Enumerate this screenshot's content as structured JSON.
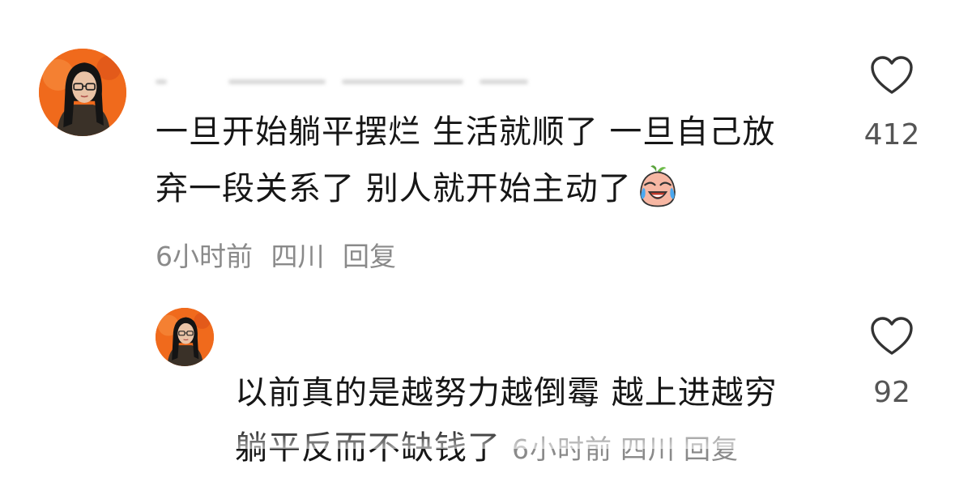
{
  "comment": {
    "line1": "一旦开始躺平摆烂   生活就顺了   一旦自己放",
    "line2": "弃一段关系了   别人就开始主动了",
    "emoji": "crying-laughing-peach-emoji",
    "time": "6小时前",
    "location": "四川",
    "reply_label": "回复",
    "likes": "412"
  },
  "reply": {
    "line1": "以前真的是越努力越倒霉   越上进越穷",
    "line2": "躺平反而不缺钱了",
    "time": "6小时前",
    "location": "四川",
    "reply_label": "回复",
    "likes": "92"
  },
  "icons": {
    "like": "heart-outline-icon"
  },
  "colors": {
    "text": "#161616",
    "meta": "#8a8a8a",
    "avatar_bg": "#f06a1c"
  }
}
